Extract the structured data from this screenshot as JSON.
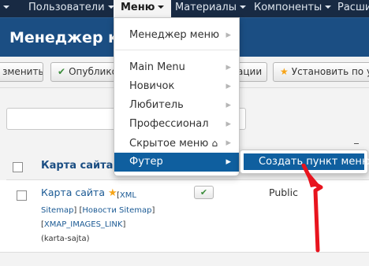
{
  "topnav": {
    "items": [
      {
        "label": "Пользователи"
      },
      {
        "label": "Меню"
      },
      {
        "label": "Материалы"
      },
      {
        "label": "Компоненты"
      },
      {
        "label": "Расши"
      }
    ]
  },
  "header": {
    "title": "Менеджер карт"
  },
  "toolbar": {
    "edit_label": "зменить",
    "publish_label": "Опублико",
    "options_label": "ации",
    "default_label": "Установить по ум"
  },
  "table": {
    "title_header": "Карта сайта",
    "row": {
      "title": "Карта сайта",
      "xml": "XML",
      "sitemap": "Sitemap",
      "news_sitemap": "Новости Sitemap",
      "images_link": "XMAP_IMAGES_LINK",
      "alias": "(karta-sajta)",
      "access": "Public"
    }
  },
  "menu_dropdown": {
    "items": [
      {
        "label": "Менеджер меню"
      },
      {
        "label": "Main Menu"
      },
      {
        "label": "Новичок"
      },
      {
        "label": "Любитель"
      },
      {
        "label": "Профессионал"
      },
      {
        "label": "Скрытое меню"
      },
      {
        "label": "Футер"
      }
    ],
    "submenu_label": "Создать пункт меню"
  },
  "colors": {
    "nav_bg": "#182a43",
    "header_bg": "#1b4e83",
    "active_menu": "#0f5f9f",
    "annotation_arrow": "#e8141e",
    "featured_star": "#f7a417"
  }
}
